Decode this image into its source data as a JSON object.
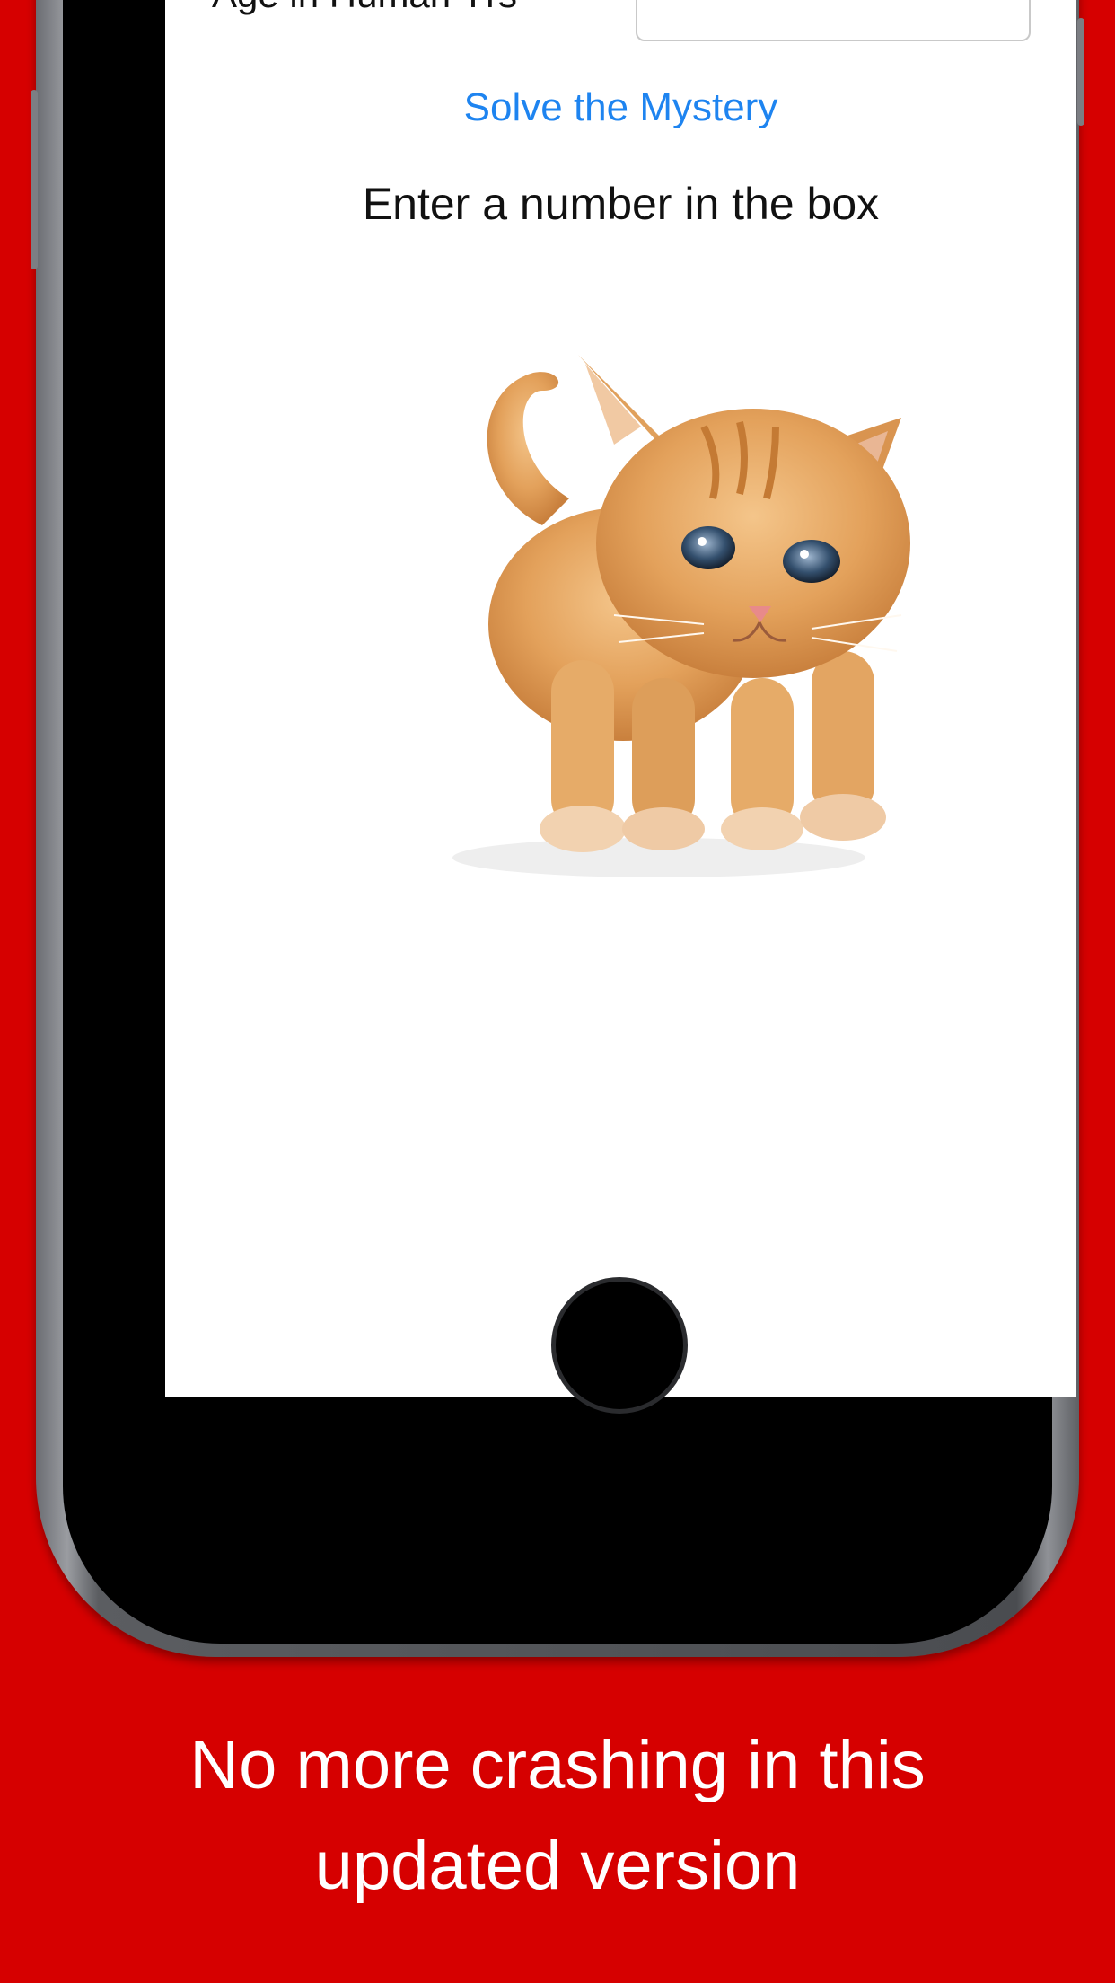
{
  "form": {
    "age_label": "Age in Human Yrs",
    "age_value": "",
    "age_placeholder": ""
  },
  "actions": {
    "solve_label": "Solve the Mystery"
  },
  "result": {
    "message": "Enter a number in the box"
  },
  "caption": {
    "line1": "No more crashing in this",
    "line2": "updated version"
  },
  "colors": {
    "background": "#d60000",
    "link": "#1e84f0",
    "caption_text": "#ffffff"
  },
  "icons": {
    "kitten": "kitten-image",
    "home": "home-button"
  }
}
